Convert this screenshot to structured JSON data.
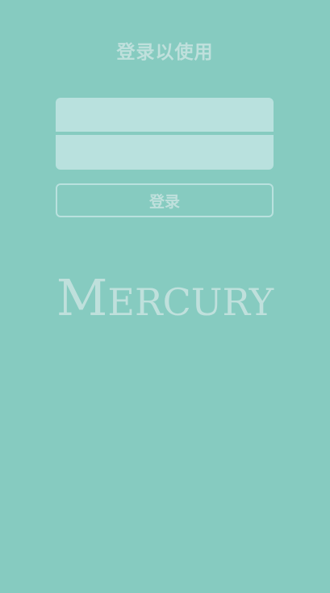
{
  "screen": {
    "title": "登录以使用"
  },
  "login_form": {
    "username_placeholder": "",
    "password_placeholder": "",
    "submit_label": "登录"
  },
  "brand": {
    "logo_text": "Mercury"
  },
  "colors": {
    "background": "#86cbc0",
    "field_fill": "#b9e1de",
    "text_light": "#bfe0dc"
  }
}
